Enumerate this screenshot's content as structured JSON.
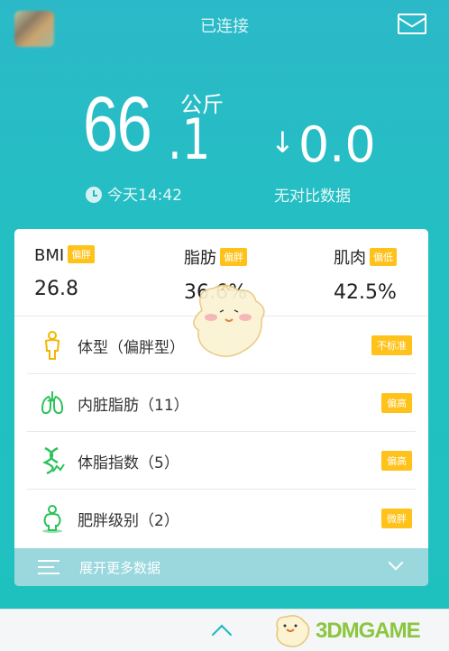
{
  "header": {
    "status": "已连接",
    "avatar_icon": "avatar-icon",
    "mail_icon": "mail-icon"
  },
  "weight": {
    "integer": "66",
    "decimal": ".1",
    "unit": "公斤",
    "time": "今天14:42",
    "diff": "0.0",
    "diff_label": "无对比数据"
  },
  "metrics": [
    {
      "name": "BMI",
      "tag": "偏胖",
      "value": "26.8"
    },
    {
      "name": "脂肪",
      "tag": "偏胖",
      "value": "36.6%"
    },
    {
      "name": "肌肉",
      "tag": "偏低",
      "value": "42.5%"
    }
  ],
  "rows": [
    {
      "label": "体型（偏胖型）",
      "badge": "不标准",
      "icon": "body-shape-icon"
    },
    {
      "label": "内脏脂肪（11）",
      "badge": "偏高",
      "icon": "lungs-icon"
    },
    {
      "label": "体脂指数（5）",
      "badge": "偏高",
      "icon": "dna-icon"
    },
    {
      "label": "肥胖级别（2）",
      "badge": "微胖",
      "icon": "obesity-icon"
    }
  ],
  "expand": {
    "label": "展开更多数据"
  },
  "watermark": {
    "text": "3DMGAME"
  },
  "colors": {
    "primary": "#22c0c2",
    "tag": "#ffc21a",
    "icon_green": "#2cc25a"
  }
}
